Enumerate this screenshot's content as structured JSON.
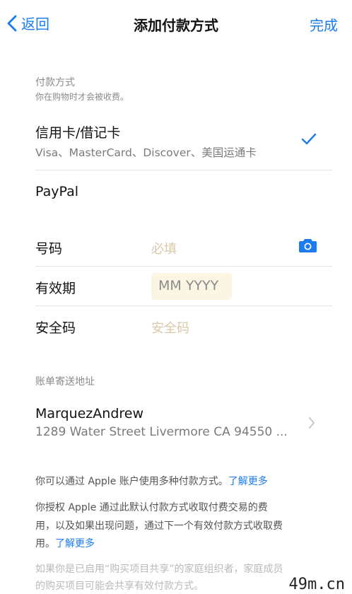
{
  "nav": {
    "back_label": "返回",
    "title": "添加付款方式",
    "done_label": "完成"
  },
  "payment_section": {
    "label": "付款方式",
    "sub": "你在购物时才会被收费。",
    "options": [
      {
        "title": "信用卡/借记卡",
        "sub": "Visa、MasterCard、Discover、美国运通卡",
        "selected": true
      },
      {
        "title": "PayPal",
        "selected": false
      }
    ]
  },
  "card_form": {
    "number_label": "号码",
    "number_placeholder": "必填",
    "expiry_label": "有效期",
    "expiry_placeholder": "MM YYYY",
    "cvv_label": "安全码",
    "cvv_placeholder": "安全码"
  },
  "billing": {
    "label": "账单寄送地址",
    "name": "MarquezAndrew",
    "address": "1289 Water Street Livermore CA 94550 ..."
  },
  "notes": {
    "line1": "你可以通过 Apple 账户使用多种付款方式。",
    "line1_link": "了解更多",
    "para2_line1": "你授权 Apple 通过此默认付款方式收取付费交易的费",
    "para2_line2": "用，以及如果出现问题，通过下一个有效付款方式收取费",
    "para2_line3": "用。",
    "para2_link": "了解更多",
    "para3_line1": "如果你是已启用“购买项目共享”的家庭组织者，家庭成员",
    "para3_line2": "的购买项目可能会共享有效付款方式。"
  },
  "watermark": "49m.cn",
  "colors": {
    "accent": "#1a7cf0",
    "placeholder": "#d9c8a6"
  }
}
